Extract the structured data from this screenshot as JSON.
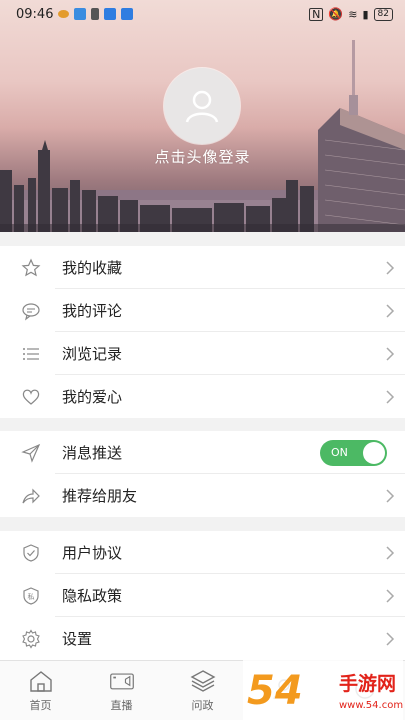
{
  "status_bar": {
    "time": "09:46",
    "battery": "82"
  },
  "header": {
    "login_text": "点击头像登录"
  },
  "sections": [
    {
      "items": [
        {
          "label": "我的收藏",
          "icon": "star-icon"
        },
        {
          "label": "我的评论",
          "icon": "comment-icon"
        },
        {
          "label": "浏览记录",
          "icon": "list-icon"
        },
        {
          "label": "我的爱心",
          "icon": "heart-icon"
        }
      ]
    },
    {
      "items": [
        {
          "label": "消息推送",
          "icon": "send-icon",
          "toggle": "ON"
        },
        {
          "label": "推荐给朋友",
          "icon": "share-icon"
        }
      ]
    },
    {
      "items": [
        {
          "label": "用户协议",
          "icon": "shield-icon"
        },
        {
          "label": "隐私政策",
          "icon": "privacy-badge-icon",
          "badge_text": "私"
        },
        {
          "label": "设置",
          "icon": "gear-icon"
        }
      ]
    }
  ],
  "bottom_nav": [
    {
      "label": "首页",
      "icon": "home-icon"
    },
    {
      "label": "直播",
      "icon": "video-camera-icon"
    },
    {
      "label": "问政",
      "icon": "layers-icon"
    },
    {
      "label": "",
      "icon": "user-icon"
    },
    {
      "label": "",
      "icon": "more-icon"
    }
  ],
  "watermark": {
    "text_main": "54",
    "text_cn": "手游网",
    "text_sub": "www.54.com"
  },
  "colors": {
    "toggle_on": "#4cb964",
    "watermark_orange": "#f39a1e"
  }
}
